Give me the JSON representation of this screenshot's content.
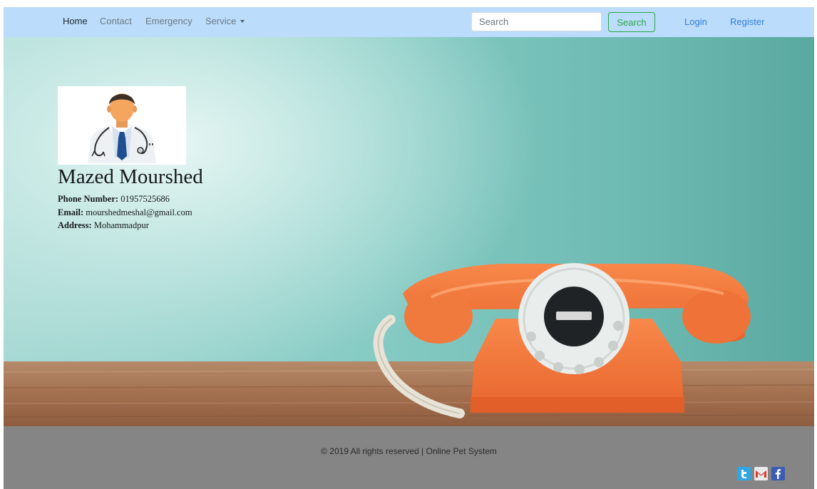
{
  "navbar": {
    "links": [
      {
        "label": "Home",
        "active": true
      },
      {
        "label": "Contact",
        "active": false
      },
      {
        "label": "Emergency",
        "active": false
      },
      {
        "label": "Service",
        "active": false,
        "dropdown": true
      }
    ],
    "search": {
      "placeholder": "Search",
      "value": ""
    },
    "search_button": "Search",
    "login": "Login",
    "register": "Register"
  },
  "profile": {
    "name": "Mazed Mourshed",
    "phone_label": "Phone Number:",
    "phone": "01957525686",
    "email_label": "Email:",
    "email": "mourshedmeshal@gmail.com",
    "address_label": "Address:",
    "address": "Mohammadpur",
    "avatar_icon": "doctor-avatar-icon"
  },
  "footer": {
    "text": "© 2019 All rights reserved | Online Pet System",
    "social": [
      "twitter-icon",
      "gmail-icon",
      "facebook-icon"
    ]
  },
  "colors": {
    "navbar_bg": "#bcdcfb",
    "success": "#28a745",
    "link": "#2f7fd8",
    "footer_bg": "#858585",
    "phone_orange": "#f2763a"
  }
}
